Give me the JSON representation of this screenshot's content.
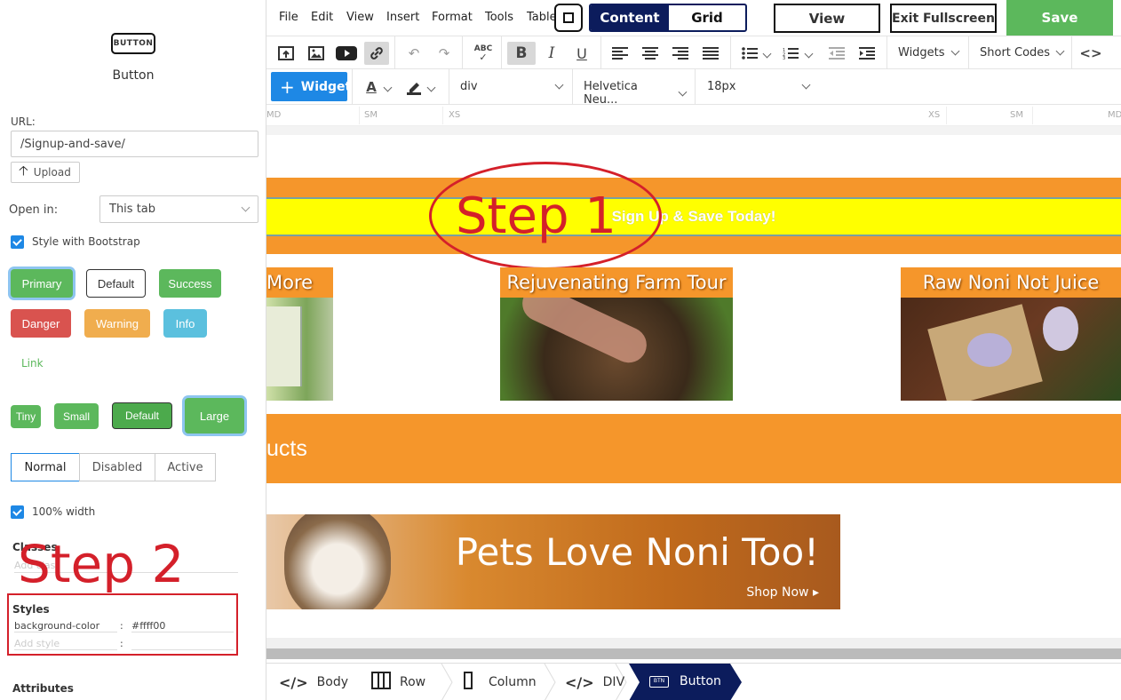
{
  "element": {
    "icon_text": "BUTTON",
    "title": "Button"
  },
  "url": {
    "label": "URL:",
    "value": "/Signup-and-save/",
    "upload_label": "Upload"
  },
  "open_in": {
    "label": "Open in:",
    "value": "This tab"
  },
  "bootstrap": {
    "label": "Style with Bootstrap",
    "checked": true
  },
  "styles_row1": [
    "Primary",
    "Default",
    "Success"
  ],
  "styles_row2": [
    "Danger",
    "Warning",
    "Info"
  ],
  "link_label": "Link",
  "sizes": [
    "Tiny",
    "Small",
    "Default",
    "Large"
  ],
  "states": [
    "Normal",
    "Disabled",
    "Active"
  ],
  "full_width": {
    "label": "100% width",
    "checked": true
  },
  "classes": {
    "label": "Classes",
    "placeholder": "Add class"
  },
  "styles": {
    "label": "Styles",
    "rows": [
      {
        "key": "background-color",
        "value": "#ffff00"
      },
      {
        "key": "Add style",
        "value": ""
      }
    ]
  },
  "attributes": {
    "label": "Attributes"
  },
  "annotations": {
    "step1": "Step 1",
    "step2": "Step 2"
  },
  "menu": [
    "File",
    "Edit",
    "View",
    "Insert",
    "Format",
    "Tools",
    "Table"
  ],
  "mode_tabs": {
    "content": "Content",
    "grid": "Grid"
  },
  "top_buttons": {
    "view": "View",
    "exit": "Exit Fullscreen",
    "save": "Save"
  },
  "toolbar": {
    "widgets": "Widgets",
    "short_codes": "Short Codes",
    "widget_button": "Widget",
    "block": "div",
    "font": "Helvetica Neu...",
    "size": "18px"
  },
  "ruler": {
    "left": [
      "MD",
      "SM",
      "XS"
    ],
    "right": [
      "XS",
      "SM",
      "MD"
    ]
  },
  "canvas": {
    "banner_text": "Sign Up & Save Today!",
    "cards": [
      "More",
      "Rejuvenating Farm Tour",
      "Raw Noni Not Juice"
    ],
    "section_text": "ucts",
    "pets": {
      "title": "Pets Love Noni Too!",
      "cta": "Shop Now ▸"
    }
  },
  "breadcrumbs": [
    "Body",
    "Row",
    "Column",
    "DIV",
    "Button"
  ],
  "colors": {
    "accent": "#1e88e5",
    "save": "#5cb85c",
    "orange": "#f5962b",
    "yellow": "#ffff00",
    "navy": "#0c1c5c",
    "annotation": "#d4202a"
  }
}
